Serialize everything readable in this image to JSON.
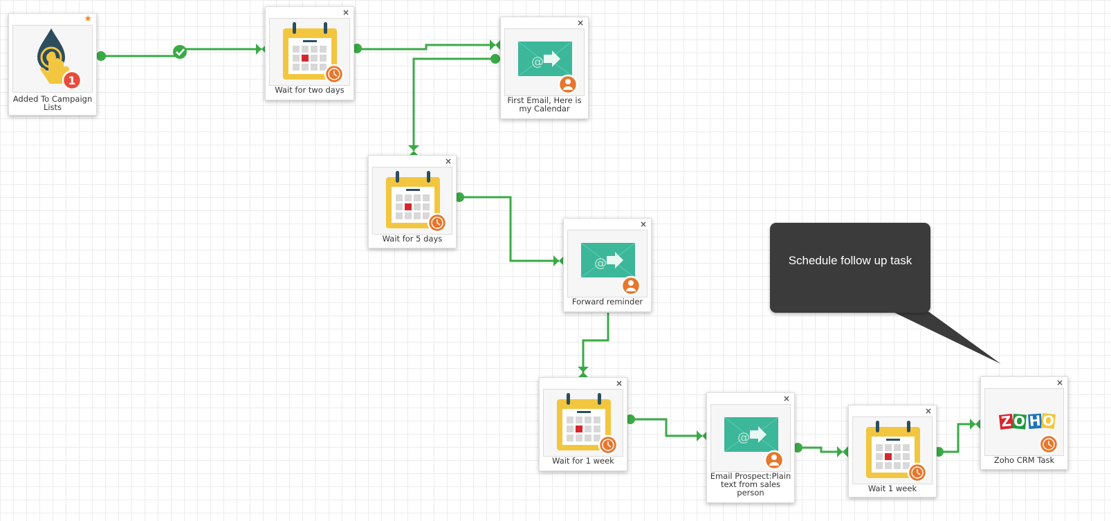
{
  "nodes": {
    "added": {
      "label": "Added To Campaign Lists",
      "badge": "1"
    },
    "wait_two_days": {
      "label": "Wait for two days"
    },
    "first_email": {
      "label": "First Email, Here is my Calendar"
    },
    "wait_5_days": {
      "label": "Wait for 5 days"
    },
    "forward_reminder": {
      "label": "Forward reminder"
    },
    "wait_1_week": {
      "label": "Wait for 1 week"
    },
    "email_prospect": {
      "label": "Email Prospect:Plain text from sales person"
    },
    "wait_1_week_b": {
      "label": "Wait 1 week"
    },
    "zoho_task": {
      "label": "Zoho CRM Task",
      "logo_letters": [
        "Z",
        "O",
        "H",
        "O"
      ]
    }
  },
  "tooltip": {
    "text": "Schedule follow up task"
  },
  "icons": {
    "close": "×",
    "star": "★",
    "email_at": "@"
  },
  "colors": {
    "connector": "#3aaa46",
    "calendar": "#f3c63f",
    "email": "#3cb79a",
    "clock": "#e8762b",
    "badge": "#e74c3c",
    "tooltip_bg": "#3b3b3b"
  }
}
